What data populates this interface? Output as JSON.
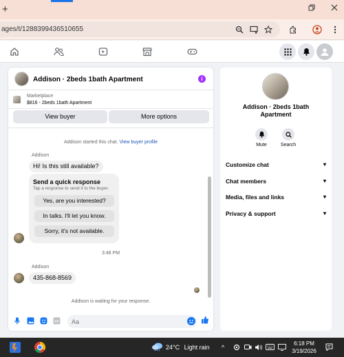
{
  "browser": {
    "new_tab": "+",
    "url": "ages/t/1288399436510655"
  },
  "header": {
    "title": "Addison · 2beds 1bath Apartment",
    "info_glyph": "i"
  },
  "marketplace": {
    "label": "Marketplace",
    "listing": "$816 - 2beds 1bath Apartment"
  },
  "actions": {
    "view_buyer": "View buyer",
    "more_options": "More options"
  },
  "chat": {
    "started_text": "Addison started this chat.",
    "view_buyer_profile": "View buyer profile",
    "sender_1": "Addison",
    "message_1": "Hi! Is this still available?",
    "quick_title": "Send a quick response",
    "quick_sub": "Tap a response to send it to the buyer.",
    "quick_responses": [
      "Yes, are you interested?",
      "In talks. I'll let you know.",
      "Sorry, it's not available."
    ],
    "timestamp": "3:48 PM",
    "sender_2": "Addison",
    "message_2": "435-868-8569",
    "waiting": "Addison is waiting for your response."
  },
  "composer": {
    "placeholder": "Aa"
  },
  "side": {
    "name": "Addison · 2beds 1bath Apartment",
    "mute": "Mute",
    "search": "Search",
    "sections": [
      "Customize chat",
      "Chat members",
      "Media, files and links",
      "Privacy & support"
    ]
  },
  "taskbar": {
    "temperature": "24°C",
    "weather": "Light rain",
    "time": "6:18 PM",
    "date": "3/19/2026"
  },
  "colors": {
    "accent": "#1877f2",
    "info": "#a033ff",
    "link": "#1a57b8"
  }
}
